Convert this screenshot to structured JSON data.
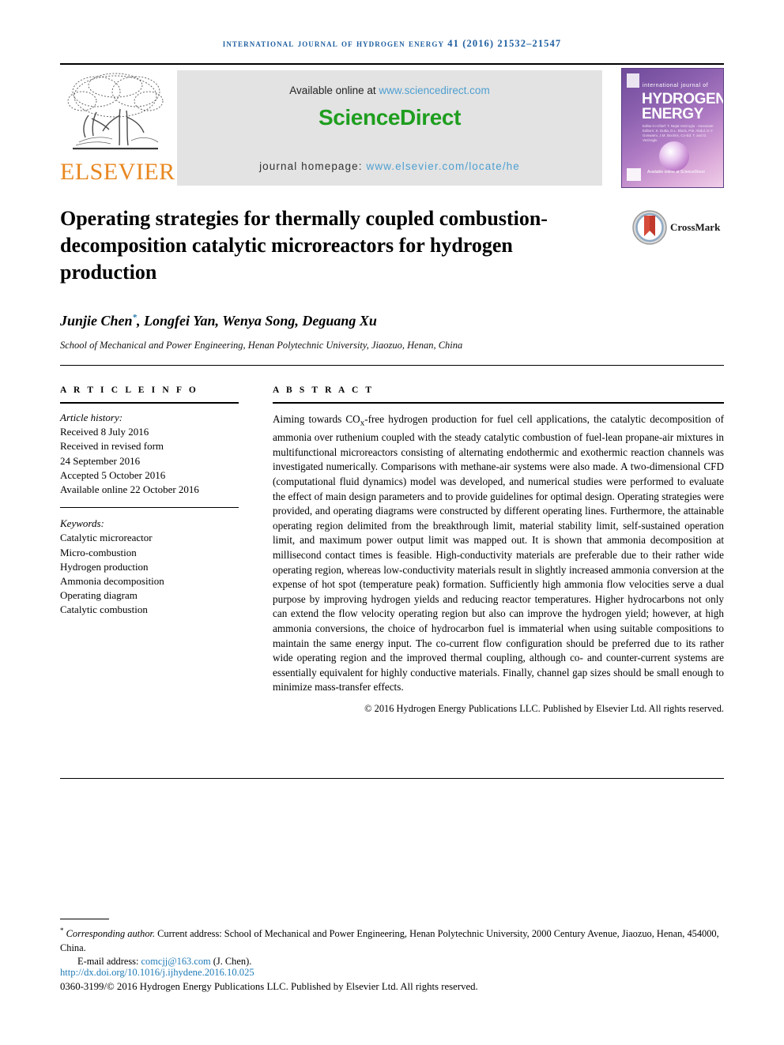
{
  "running_head": "International Journal of Hydrogen Energy 41 (2016) 21532–21547",
  "masthead": {
    "publisher_name": "ELSEVIER",
    "tree_icon": "elsevier-tree-icon",
    "available_prefix": "Available online at ",
    "available_url": "www.sciencedirect.com",
    "sciencedirect_logo": "ScienceDirect",
    "homepage_prefix": "journal homepage: ",
    "homepage_url": "www.elsevier.com/locate/he",
    "cover": {
      "line_int": "international journal of",
      "line_h1": "HYDROGEN",
      "line_h2": "ENERGY",
      "editors": "Editor-in-Chief: T. Nejat Veziroglu · Associate Editors: S. Dutta, D.L. Block, P.B. Abdul, D.Y. Goswami, J.M. Bockris, Co-Ed. T. and D. Veziroglu",
      "footer": "Available online at ScienceDirect"
    }
  },
  "article": {
    "title": "Operating strategies for thermally coupled combustion-decomposition catalytic microreactors for hydrogen production",
    "crossmark_label": "CrossMark",
    "authors": "Junjie Chen",
    "authors_rest": ", Longfei Yan, Wenya Song, Deguang Xu",
    "corresponding_marker": "*",
    "affiliation": "School of Mechanical and Power Engineering, Henan Polytechnic University, Jiaozuo, Henan, China"
  },
  "info": {
    "heading": "A R T I C L E   I N F O",
    "history_label": "Article history:",
    "history": [
      "Received 8 July 2016",
      "Received in revised form",
      "24 September 2016",
      "Accepted 5 October 2016",
      "Available online 22 October 2016"
    ],
    "keywords_label": "Keywords:",
    "keywords": [
      "Catalytic microreactor",
      "Micro-combustion",
      "Hydrogen production",
      "Ammonia decomposition",
      "Operating diagram",
      "Catalytic combustion"
    ]
  },
  "abstract": {
    "heading": "A B S T R A C T",
    "text_part1": "Aiming towards CO",
    "text_sub": "x",
    "text_part2": "-free hydrogen production for fuel cell applications, the catalytic decomposition of ammonia over ruthenium coupled with the steady catalytic combustion of fuel-lean propane-air mixtures in multifunctional microreactors consisting of alternating endothermic and exothermic reaction channels was investigated numerically. Comparisons with methane-air systems were also made. A two-dimensional CFD (computational fluid dynamics) model was developed, and numerical studies were performed to evaluate the effect of main design parameters and to provide guidelines for optimal design. Operating strategies were provided, and operating diagrams were constructed by different operating lines. Furthermore, the attainable operating region delimited from the breakthrough limit, material stability limit, self-sustained operation limit, and maximum power output limit was mapped out. It is shown that ammonia decomposition at millisecond contact times is feasible. High-conductivity materials are preferable due to their rather wide operating region, whereas low-conductivity materials result in slightly increased ammonia conversion at the expense of hot spot (temperature peak) formation. Sufficiently high ammonia flow velocities serve a dual purpose by improving hydrogen yields and reducing reactor temperatures. Higher hydrocarbons not only can extend the flow velocity operating region but also can improve the hydrogen yield; however, at high ammonia conversions, the choice of hydrocarbon fuel is immaterial when using suitable compositions to maintain the same energy input. The co-current flow configuration should be preferred due to its rather wide operating region and the improved thermal coupling, although co- and counter-current systems are essentially equivalent for highly conductive materials. Finally, channel gap sizes should be small enough to minimize mass-transfer effects.",
    "copyright": "© 2016 Hydrogen Energy Publications LLC. Published by Elsevier Ltd. All rights reserved."
  },
  "footer": {
    "corresponding_label": "Corresponding author.",
    "corresponding_text": " Current address: School of Mechanical and Power Engineering, Henan Polytechnic University, 2000 Century Avenue, Jiaozuo, Henan, 454000, China.",
    "email_label": "E-mail address: ",
    "email": "comcjj@163.com",
    "email_suffix": " (J. Chen).",
    "doi": "http://dx.doi.org/10.1016/j.ijhydene.2016.10.025",
    "issn_line": "0360-3199/© 2016 Hydrogen Energy Publications LLC. Published by Elsevier Ltd. All rights reserved."
  }
}
